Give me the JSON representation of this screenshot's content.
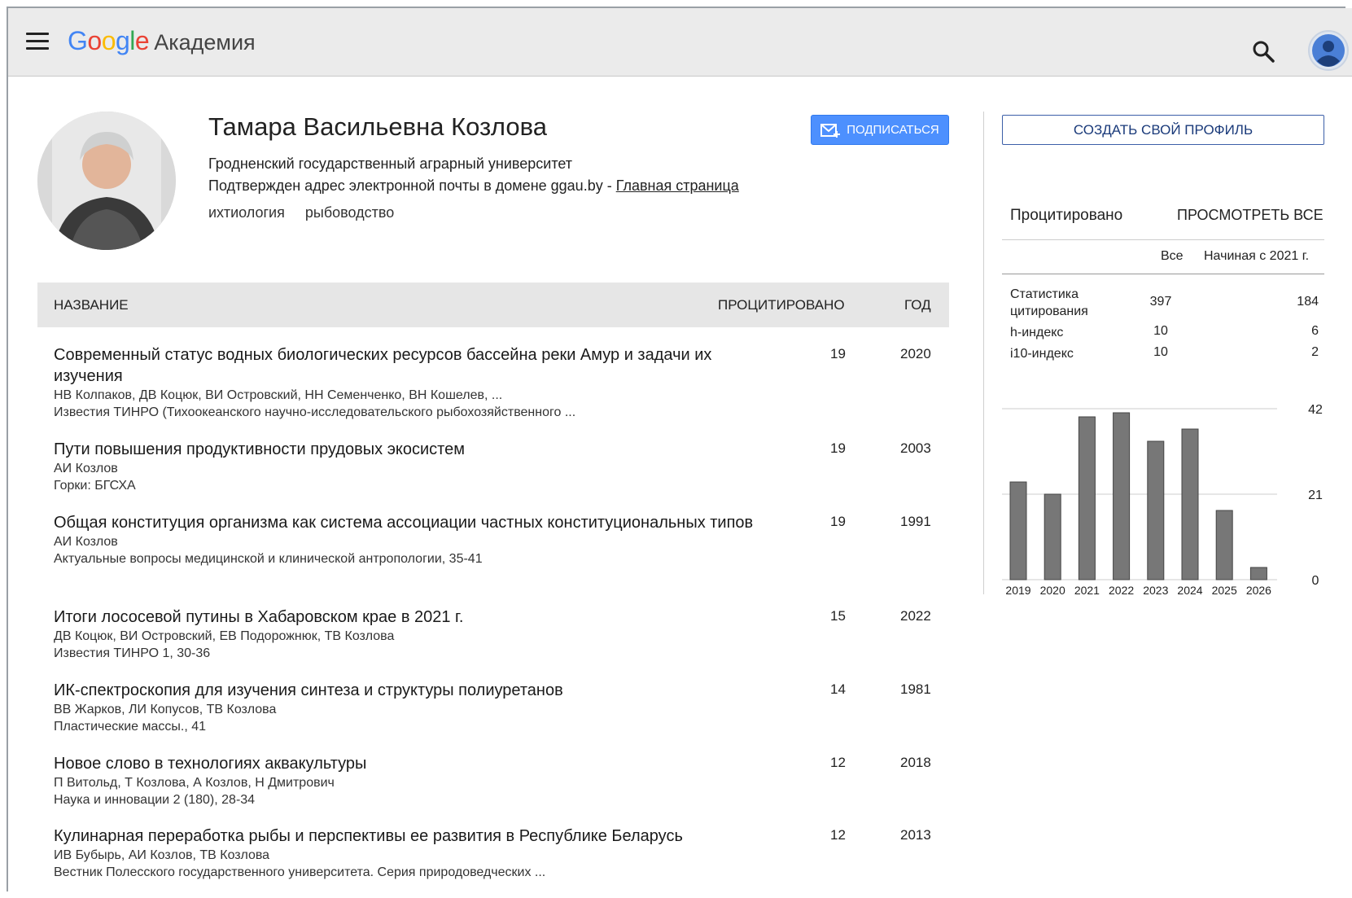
{
  "header": {
    "logo_letters": [
      "G",
      "o",
      "o",
      "g",
      "l",
      "e"
    ],
    "academy_label": "Академия",
    "icons": [
      "menu-icon",
      "search-icon",
      "account-avatar-icon"
    ]
  },
  "profile": {
    "name": "Тамара Васильевна Козлова",
    "affiliation": "Гродненский государственный аграрный университет",
    "email_text": "Подтвержден адрес электронной почты в домене ggau.by - ",
    "homepage_label": "Главная страница",
    "interests": [
      "ихтиология",
      "рыбоводство"
    ],
    "follow_label": "ПОДПИСАТЬСЯ",
    "create_profile_label": "СОЗДАТЬ СВОЙ ПРОФИЛЬ"
  },
  "table": {
    "col_title": "НАЗВАНИЕ",
    "col_cited": "ПРОЦИТИРОВАНО",
    "col_year": "ГОД",
    "rows": [
      {
        "title": "Современный статус водных биологических ресурсов бассейна реки Амур и задачи их изучения",
        "authors": "НВ Колпаков, ДВ Коцюк, ВИ Островский, НН Семенченко, ВН Кошелев, ...",
        "venue": "Известия ТИНРО (Тихоокеанского научно-исследовательского рыбохозяйственного ...",
        "cited": "19",
        "year": "2020"
      },
      {
        "title": "Пути повышения продуктивности прудовых экосистем",
        "authors": "АИ Козлов",
        "venue": "Горки: БГСХА",
        "cited": "19",
        "year": "2003"
      },
      {
        "title": "Общая конституция организма как система ассоциации частных конституциональных типов",
        "authors": "АИ Козлов",
        "venue": "Актуальные вопросы медицинской и клинической антропологии, 35-41",
        "cited": "19",
        "year": "1991"
      },
      {
        "title": "Итоги лососевой путины в Хабаровском крае в 2021 г.",
        "authors": "ДВ Коцюк, ВИ Островский, ЕВ Подорожнюк, ТВ Козлова",
        "venue": "Известия ТИНРО 1, 30-36",
        "cited": "15",
        "year": "2022"
      },
      {
        "title": "ИК-спектроскопия для изучения синтеза и структуры полиуретанов",
        "authors": "ВВ Жарков, ЛИ Копусов, ТВ Козлова",
        "venue": "Пластические массы., 41",
        "cited": "14",
        "year": "1981"
      },
      {
        "title": "Новое слово в технологиях аквакультуры",
        "authors": "П Витольд, Т Козлова, А Козлов, Н Дмитрович",
        "venue": "Наука и инновации 2 (180), 28-34",
        "cited": "12",
        "year": "2018"
      },
      {
        "title": "Кулинарная переработка рыбы и перспективы ее развития в Республике Беларусь",
        "authors": "ИВ Бубырь, АИ Козлов, ТВ Козлова",
        "venue": "Вестник Полесского государственного университета. Серия природоведческих ...",
        "cited": "12",
        "year": "2013"
      }
    ]
  },
  "citations": {
    "title": "Процитировано",
    "view_all_label": "ПРОСМОТРЕТЬ ВСЕ",
    "col_all": "Все",
    "col_since": "Начиная с 2021 г.",
    "stats": [
      {
        "label": "Статистика цитирования",
        "all": "397",
        "since": "184"
      },
      {
        "label": "h-индекс",
        "all": "10",
        "since": "6"
      },
      {
        "label": "i10-индекс",
        "all": "10",
        "since": "2"
      }
    ]
  },
  "chart_data": {
    "type": "bar",
    "categories": [
      "2019",
      "2020",
      "2021",
      "2022",
      "2023",
      "2024",
      "2025",
      "2026"
    ],
    "values": [
      24,
      21,
      40,
      41,
      34,
      37,
      17,
      3
    ],
    "yticks": [
      "42",
      "21",
      "0"
    ],
    "ylim": [
      0,
      42
    ],
    "bar_color": "#777777"
  }
}
